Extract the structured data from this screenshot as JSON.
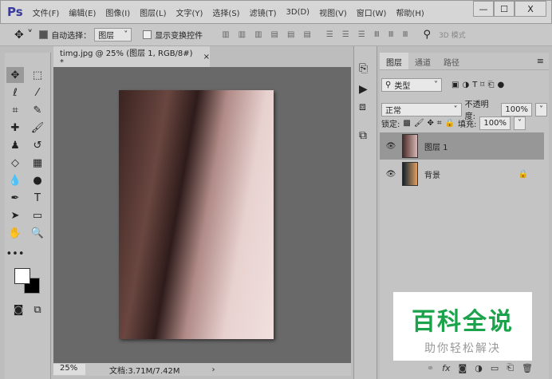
{
  "app": {
    "logo": "Ps",
    "menus": [
      "文件(F)",
      "编辑(E)",
      "图像(I)",
      "图层(L)",
      "文字(Y)",
      "选择(S)",
      "滤镜(T)",
      "3D(D)",
      "视图(V)",
      "窗口(W)",
      "帮助(H)"
    ],
    "window_buttons": [
      "—",
      "☐",
      "X"
    ]
  },
  "options": {
    "auto_select_label": "自动选择：",
    "auto_select_value": "图层",
    "show_transform_label": "显示变换控件",
    "mode_3d": "3D 模式"
  },
  "document": {
    "tab_title": "timg.jpg @ 25% (图层 1, RGB/8#) *",
    "close": "×",
    "zoom": "25%",
    "doc_info": "文档:3.71M/7.42M",
    "arrow": "›"
  },
  "layers_panel": {
    "tabs": [
      "图层",
      "通道",
      "路径"
    ],
    "filter_label": "类型",
    "blend_mode": "正常",
    "opacity_label": "不透明度:",
    "opacity": "100%",
    "lock_label": "锁定:",
    "fill_label": "填充:",
    "fill": "100%",
    "layers": [
      {
        "name": "图层 1",
        "visible": true,
        "selected": true
      },
      {
        "name": "背景",
        "visible": true,
        "locked": true
      }
    ]
  },
  "watermark": {
    "title": "百科全说",
    "subtitle": "助你轻松解决"
  }
}
